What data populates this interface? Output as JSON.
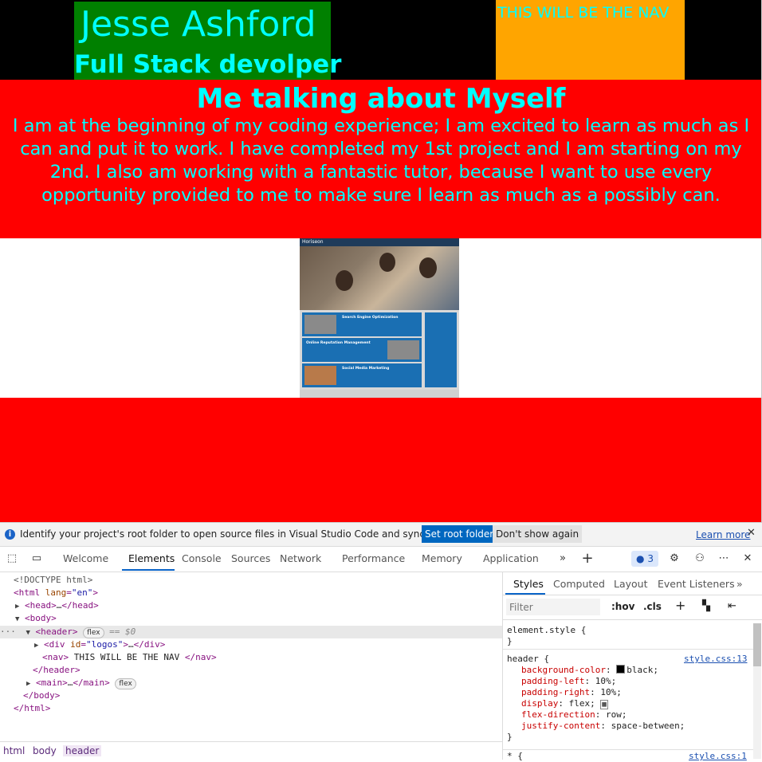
{
  "page": {
    "site_name": "Jesse Ashford",
    "site_role": "Full Stack devolper",
    "nav_text": "THIS WILL BE THE NAV",
    "about_title": "Me talking about Myself",
    "about_text": "I am at the beginning of my coding experience; I am excited to learn as much as I can and put it to work. I have completed my 1st project and I am starting on my 2nd. I also am working with a fantastic tutor, because I want to use every opportunity provided to me to make sure I learn as much as a possibly can.",
    "project_image": {
      "brand": "Horiseon",
      "cards": [
        "Search Engine Optimization",
        "Online Reputation Management",
        "Social Media Marketing"
      ]
    },
    "colors": {
      "header_bg": "#000000",
      "logos_bg": "#008000",
      "nav_bg": "#ffa500",
      "section_bg": "#ff0000",
      "text": "#00ffff"
    }
  },
  "devtools": {
    "infobar": {
      "message": "Identify your project's root folder to open source files in Visual Studio Code and sync changes.",
      "set_root_label": "Set root folder",
      "dont_show_label": "Don't show again",
      "learn_more_label": "Learn more"
    },
    "tabs": [
      "Welcome",
      "Elements",
      "Console",
      "Sources",
      "Network",
      "Performance",
      "Memory",
      "Application"
    ],
    "active_tab": "Elements",
    "issues_count": "3",
    "dom": {
      "doctype": "<!DOCTYPE html>",
      "html_open_tag": "html",
      "html_lang_attr": "lang",
      "html_lang_value": "\"en\"",
      "head": "head",
      "head_ellipsis": "…",
      "body": "body",
      "header": "header",
      "flex_badge": "flex",
      "selected_marker": "== $0",
      "div_tag": "div",
      "div_id_attr": "id",
      "div_id_value": "\"logos\"",
      "nav_tag": "nav",
      "nav_text": " THIS WILL BE THE NAV ",
      "main_tag": "main"
    },
    "breadcrumbs": [
      "html",
      "body",
      "header"
    ],
    "styles": {
      "tabs": [
        "Styles",
        "Computed",
        "Layout",
        "Event Listeners"
      ],
      "filter_placeholder": "Filter",
      "hov_label": ":hov",
      "cls_label": ".cls",
      "element_style_selector": "element.style {",
      "close_brace": "}",
      "header_selector": "header {",
      "header_source": "style.css:13",
      "declarations": [
        {
          "prop": "background-color",
          "value": "black;"
        },
        {
          "prop": "padding-left",
          "value": "10%;"
        },
        {
          "prop": "padding-right",
          "value": "10%;"
        },
        {
          "prop": "display",
          "value": "flex;"
        },
        {
          "prop": "flex-direction",
          "value": "row;"
        },
        {
          "prop": "justify-content",
          "value": "space-between;"
        }
      ],
      "universal_selector": "* {",
      "universal_source": "style.css:1"
    }
  }
}
